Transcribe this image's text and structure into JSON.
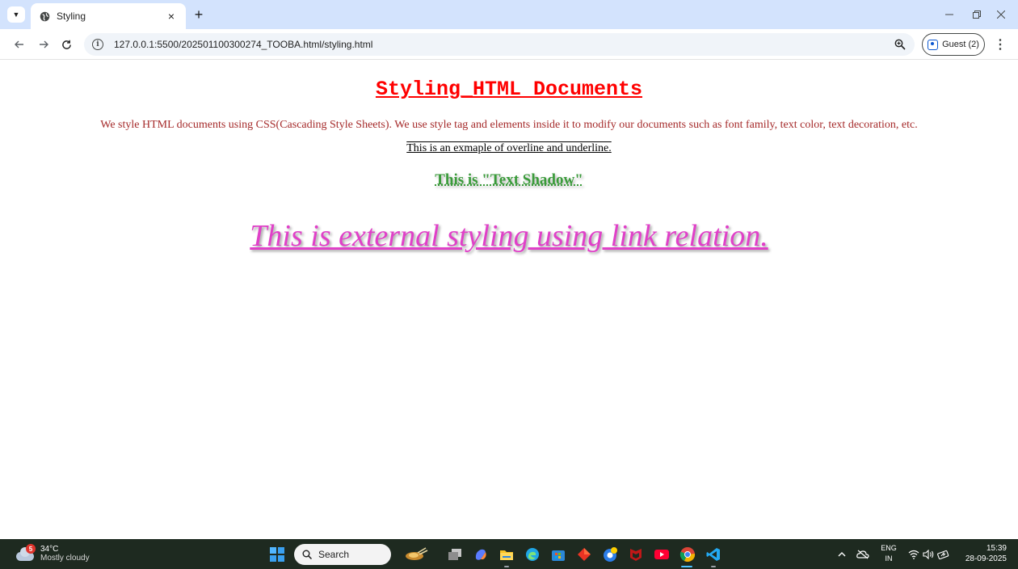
{
  "browser": {
    "tab_title": "Styling",
    "tab_close": "×",
    "new_tab": "+",
    "url": "127.0.0.1:5500/202501100300274_TOOBA.html/styling.html",
    "profile_label": "Guest (2)",
    "icons": {
      "tab_search": "chevron-down-icon",
      "favicon": "globe-icon",
      "back": "arrow-left-icon",
      "forward": "arrow-right-icon",
      "reload": "reload-icon",
      "site_info": "info-icon",
      "zoom": "zoom-icon",
      "menu": "more-vertical-icon"
    }
  },
  "page": {
    "heading": "Styling_HTML Documents",
    "paragraph": "We style HTML documents using CSS(Cascading Style Sheets). We use style tag and elements inside it to modify our documents such as font family, text color, text decoration, etc.",
    "overline_text": "This is an exmaple of overline and underline.",
    "shadow_text": "This is \"Text Shadow\"",
    "external_text": "This is external styling using link relation.",
    "colors": {
      "heading": "#ff0000",
      "paragraph": "#a52a2a",
      "shadow_text": "#3a9b3a",
      "external_text": "#e040c8"
    }
  },
  "taskbar": {
    "weather_badge": "5",
    "weather_temp": "34°C",
    "weather_desc": "Mostly cloudy",
    "search_label": "Search",
    "lang_line1": "ENG",
    "lang_line2": "IN",
    "time": "15:39",
    "date": "28-09-2025",
    "apps": [
      "copilot-icon",
      "task-view-icon",
      "edge-copilot-icon",
      "file-explorer-icon",
      "edge-icon",
      "store-icon",
      "app-diamond-icon",
      "chrome-canary-icon",
      "mcafee-icon",
      "youtube-icon",
      "chrome-icon",
      "vscode-icon"
    ]
  }
}
